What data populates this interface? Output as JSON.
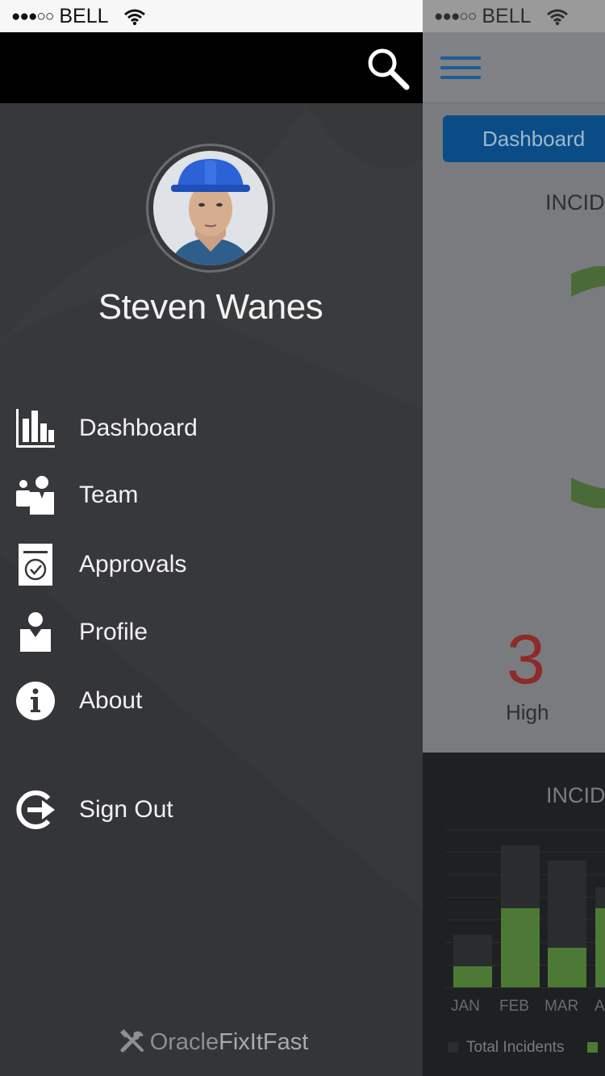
{
  "status_bar": {
    "signal": "●●●○○",
    "carrier": "BELL"
  },
  "drawer": {
    "search_icon": "search-icon",
    "user_name": "Steven Wanes",
    "nav": [
      {
        "label": "Dashboard",
        "icon": "bar-chart-icon"
      },
      {
        "label": "Team",
        "icon": "team-icon"
      },
      {
        "label": "Approvals",
        "icon": "clipboard-check-icon"
      },
      {
        "label": "Profile",
        "icon": "user-icon"
      },
      {
        "label": "About",
        "icon": "info-icon"
      },
      {
        "label": "Sign Out",
        "icon": "sign-out-icon"
      }
    ],
    "brand": {
      "part1": "Oracle",
      "part2": "FixItFast",
      "icon": "tools-icon"
    }
  },
  "main": {
    "dashboard_button": "Dashboard",
    "section_title_top": "INCID",
    "high_count": "3",
    "high_label": "High",
    "section_title_bottom": "INCID",
    "colors": {
      "accent": "#0a4d86",
      "high": "#8e2a28",
      "bar": "#4c7a36"
    }
  },
  "chart_data": {
    "type": "bar",
    "categories": [
      "JAN",
      "FEB",
      "MAR",
      "A"
    ],
    "series": [
      {
        "name": "Total Incidents",
        "values": [
          2,
          5.4,
          4.8,
          3.8
        ]
      },
      {
        "name": "",
        "values": [
          0.8,
          3,
          1.5,
          3
        ]
      }
    ],
    "legend": "bottom"
  }
}
